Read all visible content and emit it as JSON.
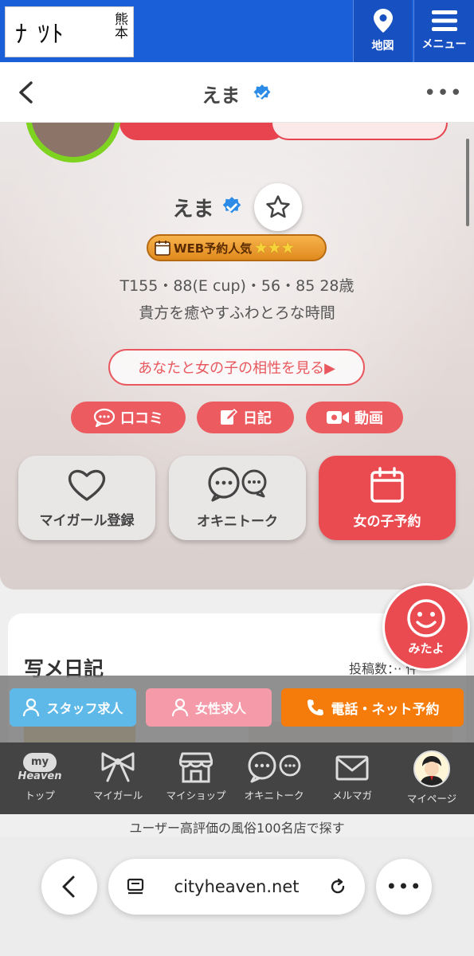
{
  "topbar": {
    "logo_text": "ﾅ ﾂﾄ",
    "logo_city": "熊本",
    "map_label": "地図",
    "menu_label": "メニュー"
  },
  "header": {
    "title": "えま",
    "more": "•••"
  },
  "profile": {
    "name": "えま",
    "badge_text": "WEB予約人気",
    "badge_stars": "★★★",
    "stats": "T155・88(E cup)・56・85  28歳",
    "catchphrase": "貴方を癒やすふわとろな時間",
    "compat_link": "あなたと女の子の相性を見る▶"
  },
  "pills": {
    "review": "口コミ",
    "diary": "日記",
    "video": "動画"
  },
  "actions": {
    "favorite": "マイガール登録",
    "talk": "オキニトーク",
    "reserve": "女の子予約"
  },
  "mitayo": {
    "label": "みたよ"
  },
  "diary": {
    "title": "写メ日記",
    "post_count": "投稿数：·· 件"
  },
  "recruit": {
    "staff": "スタッフ求人",
    "female": "女性求人",
    "phone": "電話・ネット予約"
  },
  "bottom_nav": {
    "top": "トップ",
    "top_icon_top": "my",
    "top_icon_bottom": "Heaven",
    "mygirl": "マイガール",
    "myshop": "マイショップ",
    "talk": "オキニトーク",
    "mail": "メルマガ",
    "mypage": "マイページ"
  },
  "footer": {
    "text": "ユーザー高評価の風俗100名店で探す"
  },
  "browser": {
    "url": "cityheaven.net"
  },
  "colors": {
    "primary_blue": "#1a5fd8",
    "accent_red": "#ea4b50",
    "verified_blue": "#2b8be6",
    "orange": "#f57c0a"
  }
}
